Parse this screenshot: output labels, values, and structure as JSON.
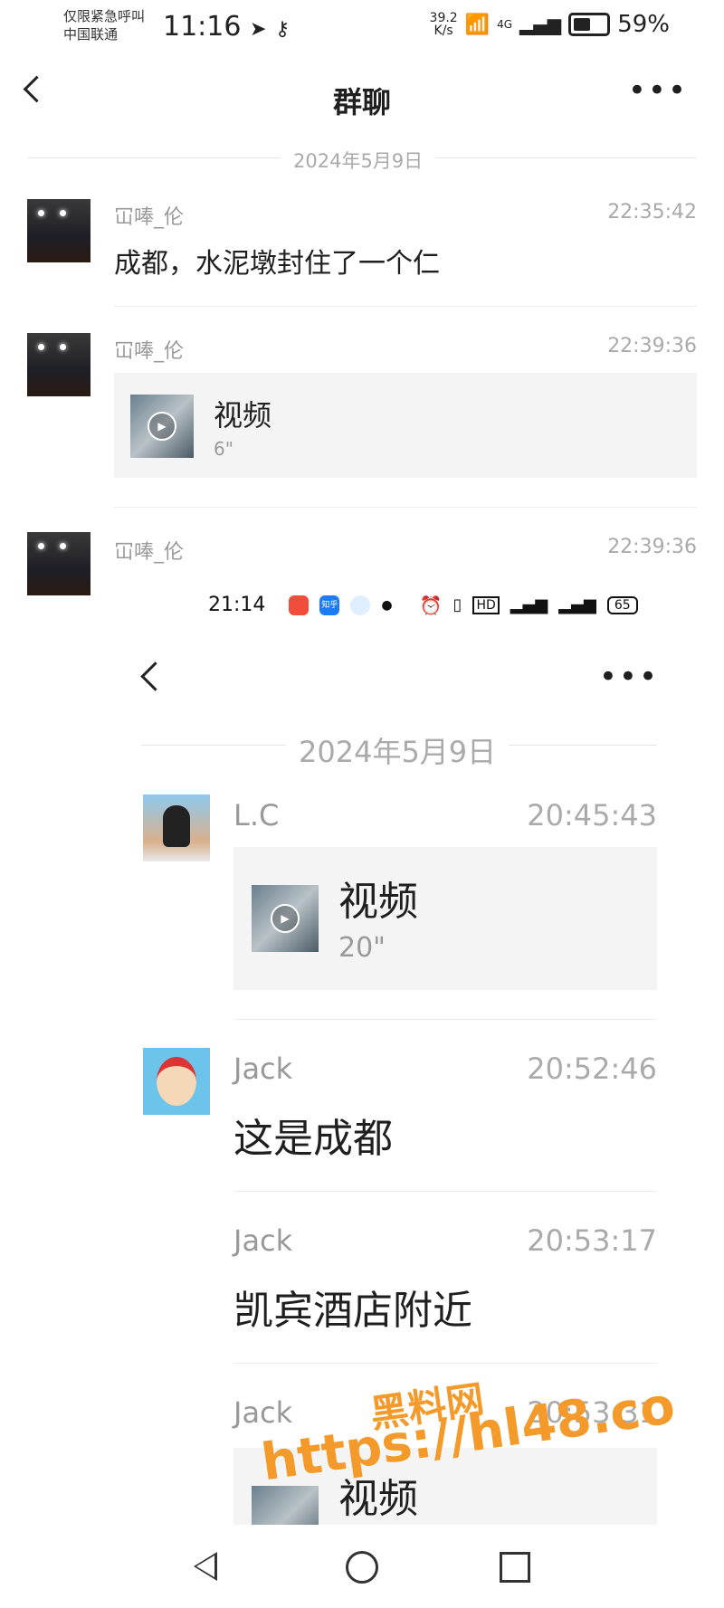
{
  "status_bar": {
    "carrier_line1": "仅限紧急呼叫",
    "carrier_line2": "中国联通",
    "time": "11:16",
    "speed_value": "39.2",
    "speed_unit": "K/s",
    "network": "4G",
    "battery": "59%"
  },
  "header": {
    "title": "群聊",
    "more": "•••"
  },
  "date_divider": "2024年5月9日",
  "messages": [
    {
      "sender": "冚唪_伦",
      "time": "22:35:42",
      "text": "成都，水泥墩封住了一个仁"
    },
    {
      "sender": "冚唪_伦",
      "time": "22:39:36",
      "video_label": "视频",
      "duration": "6\""
    },
    {
      "sender": "冚唪_伦",
      "time": "22:39:36"
    }
  ],
  "embedded": {
    "status_time": "21:14",
    "app_icon_label": "知乎",
    "battery": "65",
    "more": "•••",
    "date_divider": "2024年5月9日",
    "messages": [
      {
        "sender": "L.C",
        "time": "20:45:43",
        "video_label": "视频",
        "duration": "20\""
      },
      {
        "sender": "Jack",
        "time": "20:52:46",
        "text": "这是成都"
      },
      {
        "sender": "Jack",
        "time": "20:53:17",
        "text": "凯宾酒店附近"
      },
      {
        "sender": "Jack",
        "time": "20:53:31",
        "video_label": "视频"
      }
    ]
  },
  "watermark": {
    "line1": "黑料网",
    "line2": "https://hl48.co"
  },
  "colors": {
    "watermark": "#f39a2b",
    "secondary_text": "#999999",
    "card_bg": "#f4f4f4"
  }
}
